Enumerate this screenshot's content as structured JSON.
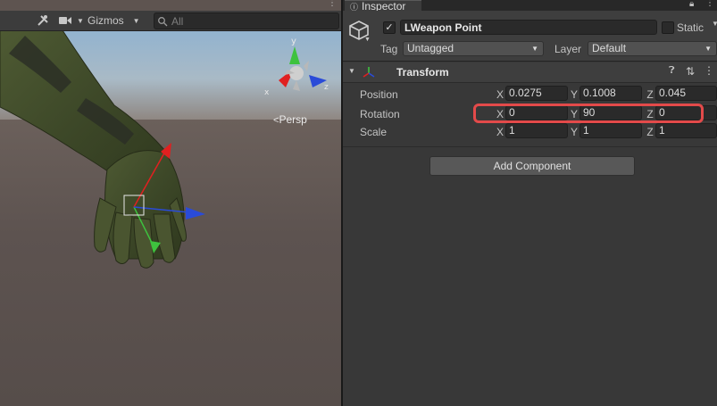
{
  "scene": {
    "gizmos_label": "Gizmos",
    "search_placeholder": "All",
    "persp_label": "Persp",
    "axis_labels": {
      "x": "x",
      "y": "y",
      "z": "z"
    }
  },
  "inspector": {
    "tab_label": "Inspector",
    "object_name": "LWeapon Point",
    "active": true,
    "static_label": "Static",
    "tag_label": "Tag",
    "tag_value": "Untagged",
    "layer_label": "Layer",
    "layer_value": "Default",
    "component_title": "Transform",
    "add_component_label": "Add Component",
    "rows": [
      {
        "label": "Position",
        "x_axis": "X",
        "x": "0.0275",
        "y_axis": "Y",
        "y": "0.1008",
        "z_axis": "Z",
        "z": "0.045"
      },
      {
        "label": "Rotation",
        "x_axis": "X",
        "x": "0",
        "y_axis": "Y",
        "y": "90",
        "z_axis": "Z",
        "z": "0"
      },
      {
        "label": "Scale",
        "x_axis": "X",
        "x": "1",
        "y_axis": "Y",
        "y": "1",
        "z_axis": "Z",
        "z": "1"
      }
    ]
  },
  "colors": {
    "highlight": "#e34a4a",
    "axis_x": "#e02020",
    "axis_y": "#3ec23e",
    "axis_z": "#2a4bd8"
  }
}
